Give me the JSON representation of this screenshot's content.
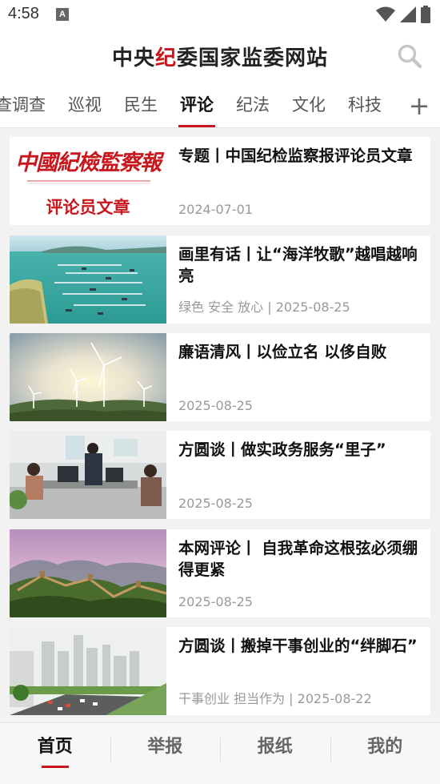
{
  "status_bar": {
    "time": "4:58",
    "notification_glyph": "A"
  },
  "header": {
    "title_pre": "中央",
    "title_accent": "纪",
    "title_post": "委国家监委网站"
  },
  "tabs": [
    {
      "label": "查调查"
    },
    {
      "label": "巡视"
    },
    {
      "label": "民生"
    },
    {
      "label": "评论",
      "active": true
    },
    {
      "label": "纪法"
    },
    {
      "label": "文化"
    },
    {
      "label": "科技"
    }
  ],
  "add_tab_glyph": "+",
  "articles": [
    {
      "title": "专题丨中国纪检监察报评论员文章",
      "meta": "2024-07-01",
      "image": {
        "kind": "banner",
        "masthead": "中國紀檢監察報",
        "caption": "评论员文章"
      }
    },
    {
      "title": "画里有话丨让“海洋牧歌”越唱越响亮",
      "meta": "绿色 安全 放心 | 2025-08-25",
      "image": {
        "kind": "sea"
      }
    },
    {
      "title": "廉语清风丨以俭立名 以侈自败",
      "meta": "2025-08-25",
      "image": {
        "kind": "wind"
      }
    },
    {
      "title": "方圆谈丨做实政务服务“里子”",
      "meta": "2025-08-25",
      "image": {
        "kind": "office"
      }
    },
    {
      "title": "本网评论丨 自我革命这根弦必须绷得更紧",
      "meta": "2025-08-25",
      "image": {
        "kind": "wall"
      }
    },
    {
      "title": "方圆谈丨搬掉干事创业的“绊脚石”",
      "meta": "干事创业 担当作为 | 2025-08-22",
      "image": {
        "kind": "city"
      }
    }
  ],
  "bottom_nav": [
    {
      "label": "首页",
      "active": true
    },
    {
      "label": "举报"
    },
    {
      "label": "报纸"
    },
    {
      "label": "我的"
    }
  ],
  "colors": {
    "brand_red": "#c8161d",
    "text": "#111111",
    "meta": "#999999"
  }
}
